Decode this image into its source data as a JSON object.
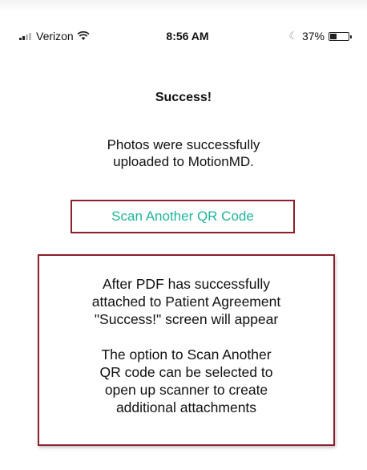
{
  "status_bar": {
    "carrier": "Verizon",
    "time": "8:56 AM",
    "battery_text": "37%",
    "battery_level": 0.37,
    "icons": [
      "signal-icon",
      "wifi-icon",
      "moon-icon",
      "battery-icon"
    ]
  },
  "screen": {
    "title": "Success!",
    "message_lines": [
      "Photos were successfully",
      "uploaded to MotionMD."
    ],
    "scan_button_label": "Scan Another QR Code"
  },
  "annotation": {
    "paragraph1_lines": [
      "After PDF has successfully",
      "attached to Patient Agreement",
      "\"Success!\" screen will appear"
    ],
    "paragraph2_lines": [
      "The option to Scan Another",
      "QR code can be selected to",
      "open up scanner to create",
      "additional attachments"
    ]
  },
  "colors": {
    "accent": "#1fb59a",
    "annotation_border": "#8b1f2b"
  }
}
